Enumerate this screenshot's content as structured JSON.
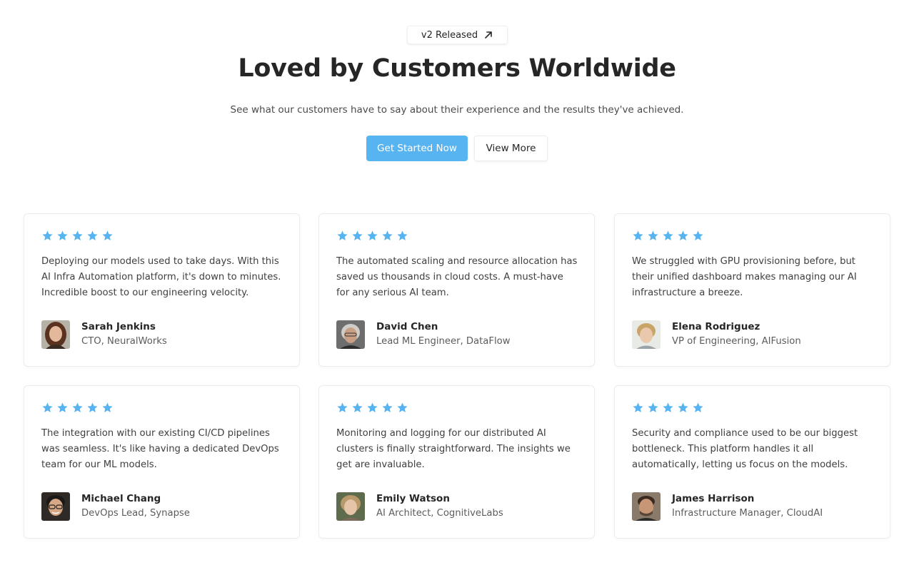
{
  "hero": {
    "badge_label": "v2 Released",
    "badge_icon": "arrow-up-right-icon",
    "title": "Loved by Customers Worldwide",
    "subtitle": "See what our customers have to say about their experience and the results they've achieved.",
    "primary_button": "Get Started Now",
    "secondary_button": "View More"
  },
  "colors": {
    "accent": "#58b4f0",
    "star": "#58b4f0",
    "text": "#262626",
    "muted": "#5c5c5c"
  },
  "testimonials": [
    {
      "rating": 5,
      "quote": "Deploying our models used to take days. With this AI Infra Automation platform, it's down to minutes. Incredible boost to our engineering velocity.",
      "name": "Sarah Jenkins",
      "role": "CTO, NeuralWorks"
    },
    {
      "rating": 5,
      "quote": "The automated scaling and resource allocation has saved us thousands in cloud costs. A must-have for any serious AI team.",
      "name": "David Chen",
      "role": "Lead ML Engineer, DataFlow"
    },
    {
      "rating": 5,
      "quote": "We struggled with GPU provisioning before, but their unified dashboard makes managing our AI infrastructure a breeze.",
      "name": "Elena Rodriguez",
      "role": "VP of Engineering, AIFusion"
    },
    {
      "rating": 5,
      "quote": "The integration with our existing CI/CD pipelines was seamless. It's like having a dedicated DevOps team for our ML models.",
      "name": "Michael Chang",
      "role": "DevOps Lead, Synapse"
    },
    {
      "rating": 5,
      "quote": "Monitoring and logging for our distributed AI clusters is finally straightforward. The insights we get are invaluable.",
      "name": "Emily Watson",
      "role": "AI Architect, CognitiveLabs"
    },
    {
      "rating": 5,
      "quote": "Security and compliance used to be our biggest bottleneck. This platform handles it all automatically, letting us focus on the models.",
      "name": "James Harrison",
      "role": "Infrastructure Manager, CloudAI"
    }
  ]
}
